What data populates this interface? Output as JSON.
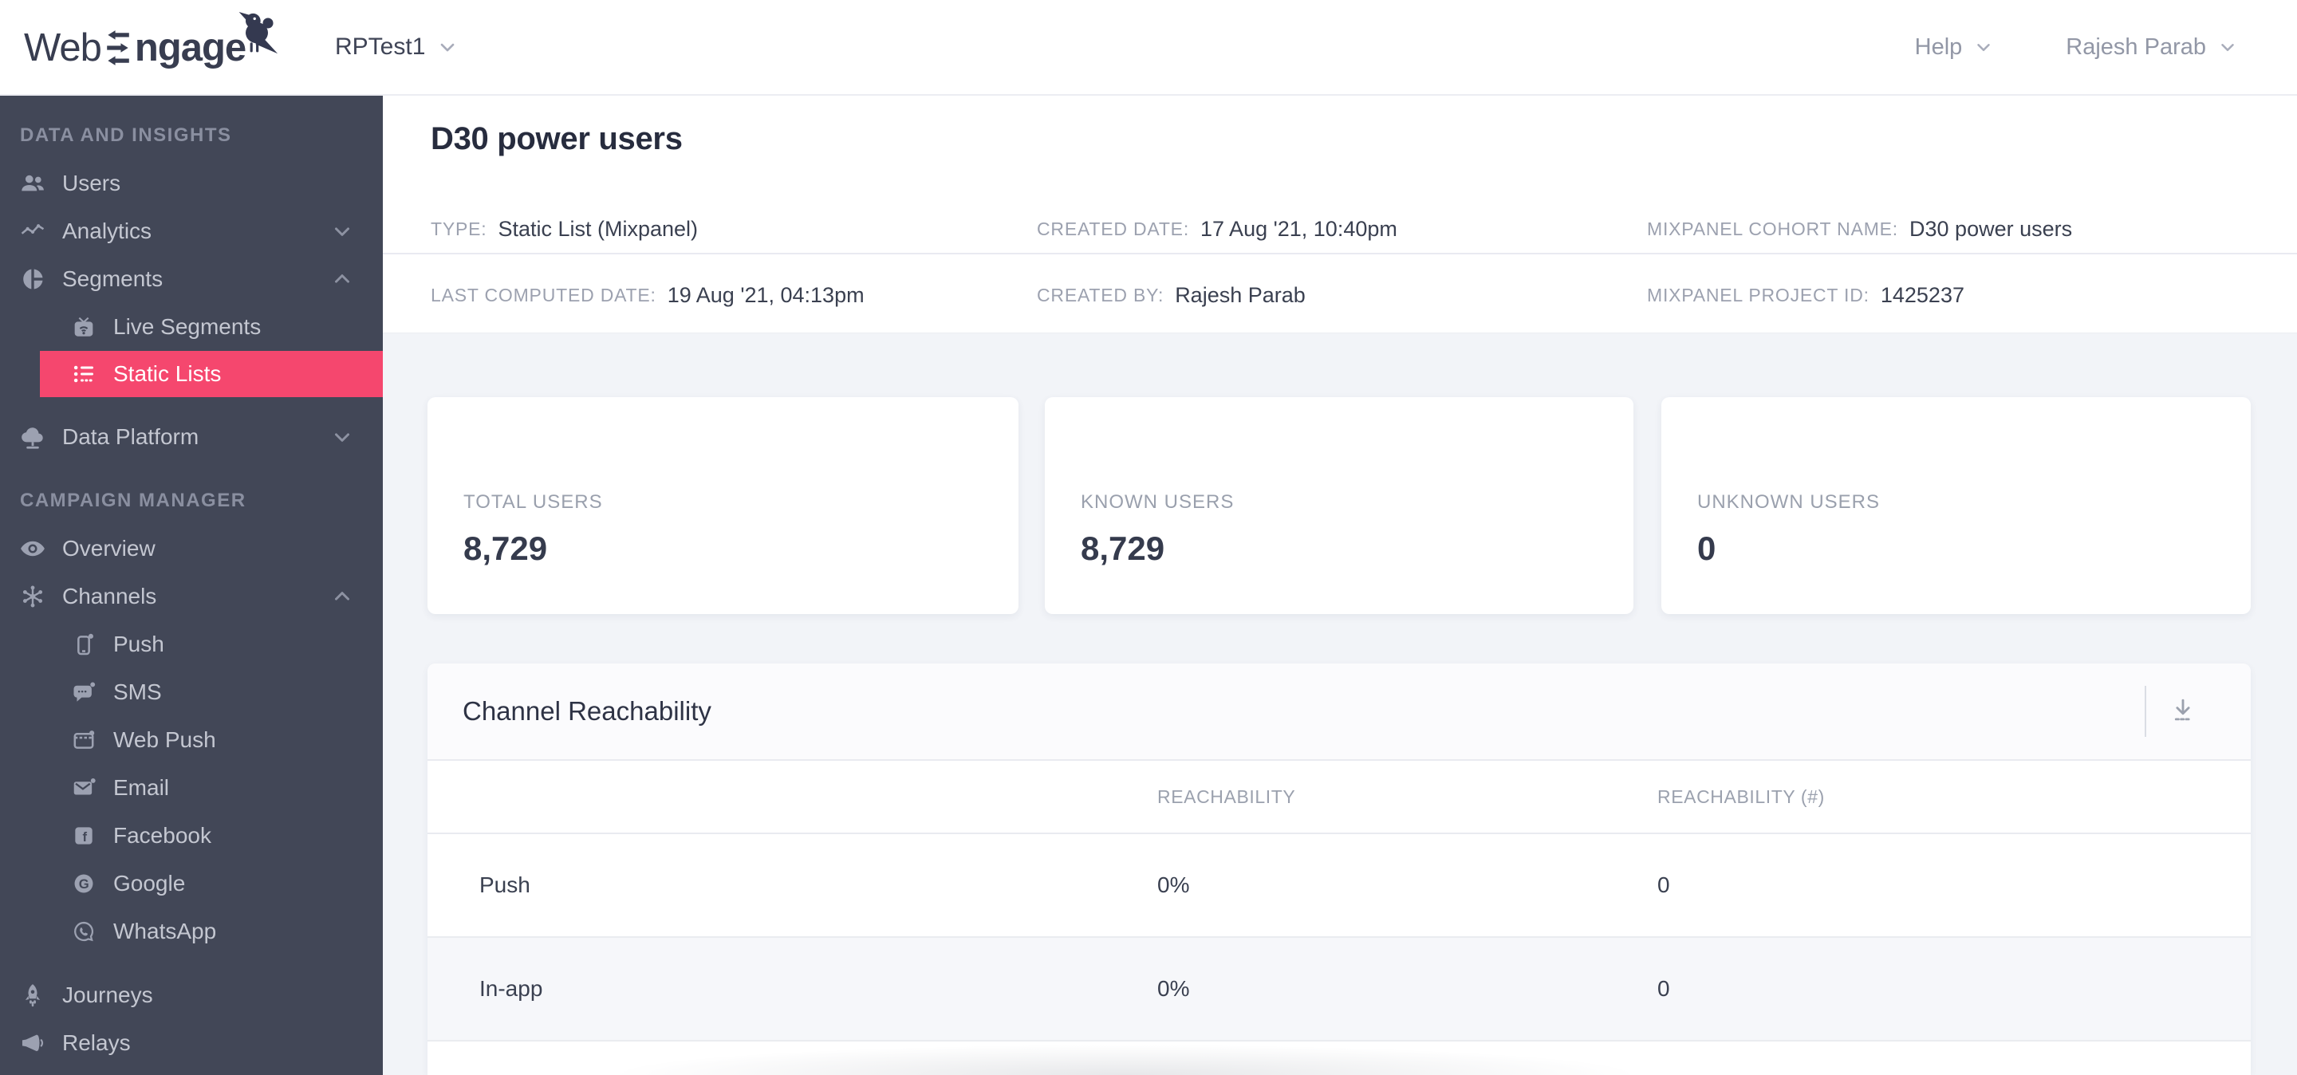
{
  "topbar": {
    "logo_web": "Web",
    "logo_ngage": "ngage",
    "project_name": "RPTest1",
    "help_label": "Help",
    "user_name": "Rajesh Parab"
  },
  "sidebar": {
    "sections": [
      {
        "title": "DATA AND INSIGHTS",
        "items": [
          {
            "label": "Users"
          },
          {
            "label": "Analytics"
          },
          {
            "label": "Segments"
          },
          {
            "label": "Live Segments"
          },
          {
            "label": "Static Lists"
          },
          {
            "label": "Data Platform"
          }
        ]
      },
      {
        "title": "CAMPAIGN MANAGER",
        "items": [
          {
            "label": "Overview"
          },
          {
            "label": "Channels"
          },
          {
            "label": "Push"
          },
          {
            "label": "SMS"
          },
          {
            "label": "Web Push"
          },
          {
            "label": "Email"
          },
          {
            "label": "Facebook"
          },
          {
            "label": "Google"
          },
          {
            "label": "WhatsApp"
          },
          {
            "label": "Journeys"
          },
          {
            "label": "Relays"
          }
        ]
      }
    ]
  },
  "page": {
    "title": "D30 power users",
    "meta_row1": [
      {
        "label": "TYPE:",
        "value": "Static List (Mixpanel)"
      },
      {
        "label": "CREATED DATE:",
        "value": "17 Aug '21, 10:40pm"
      },
      {
        "label": "MIXPANEL COHORT NAME:",
        "value": "D30 power users"
      }
    ],
    "meta_row2": [
      {
        "label": "LAST COMPUTED DATE:",
        "value": "19 Aug '21, 04:13pm"
      },
      {
        "label": "CREATED BY:",
        "value": "Rajesh Parab"
      },
      {
        "label": "MIXPANEL PROJECT ID:",
        "value": "1425237"
      }
    ],
    "stats": [
      {
        "label": "TOTAL USERS",
        "value": "8,729"
      },
      {
        "label": "KNOWN USERS",
        "value": "8,729"
      },
      {
        "label": "UNKNOWN USERS",
        "value": "0"
      }
    ],
    "reachability": {
      "title": "Channel Reachability",
      "columns": [
        "REACHABILITY",
        "REACHABILITY (#)"
      ],
      "rows": [
        {
          "channel": "Push",
          "reachability": "0%",
          "count": "0"
        },
        {
          "channel": "In-app",
          "reachability": "0%",
          "count": "0"
        }
      ]
    }
  },
  "colors": {
    "accent_pink": "#F5476E",
    "sidebar_bg": "#424757",
    "page_bg": "#F2F4F8",
    "text_dark": "#3A4050",
    "text_gray": "#9BA1AE"
  }
}
